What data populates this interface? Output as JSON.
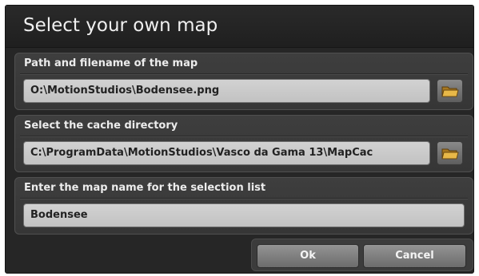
{
  "dialog": {
    "title": "Select your own map",
    "buttons": {
      "ok_label": "Ok",
      "cancel_label": "Cancel"
    }
  },
  "map_path": {
    "label": "Path and filename of the map",
    "value": "O:\\MotionStudios\\Bodensee.png",
    "browse_icon": "folder-icon"
  },
  "cache_directory": {
    "label": "Select the cache directory",
    "value": "C:\\ProgramData\\MotionStudios\\Vasco da Gama 13\\MapCac",
    "browse_icon": "folder-icon"
  },
  "map_name": {
    "label": "Enter the map name for the selection list",
    "value": "Bodensee"
  },
  "colors": {
    "background": "#262626",
    "panel": "#3a3a3a",
    "field": "#c8c8c8",
    "button": "#7c7c7c",
    "folder": "#e0b040"
  }
}
